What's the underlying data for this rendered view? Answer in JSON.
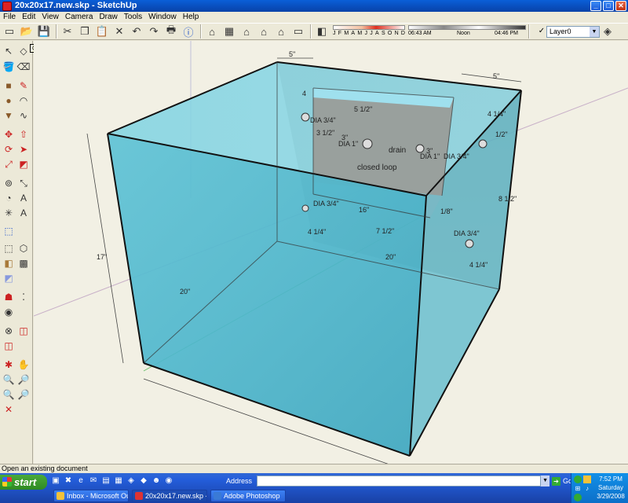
{
  "window": {
    "title": "20x20x17.new.skp - SketchUp",
    "min": "_",
    "max": "□",
    "close": "✕"
  },
  "menu": [
    "File",
    "Edit",
    "View",
    "Camera",
    "Draw",
    "Tools",
    "Window",
    "Help"
  ],
  "toolbar": {
    "months": [
      "J",
      "F",
      "M",
      "A",
      "M",
      "J",
      "J",
      "A",
      "S",
      "O",
      "N",
      "D"
    ],
    "time_start": "06:43 AM",
    "time_noon": "Noon",
    "time_end": "04:46 PM",
    "layer_check": "✓",
    "layer_name": "Layer0"
  },
  "tooltip": "Open",
  "model": {
    "dims": {
      "top_width": "5\"",
      "top_right": "5\"",
      "height": "17\"",
      "front_left": "20\"",
      "back_bottom": "20\"",
      "overflow_width": "5 1/2\"",
      "left_4": "4",
      "right_4_1_4": "4 1/4\"",
      "right_1_2": "1/2\"",
      "right_8_1_2": "8 1/2\"",
      "box_3_1_2": "3 1/2\"",
      "dim_3_left": "3\"",
      "dim_3_right": "3\"",
      "dim_16": "16\"",
      "dim_1_8": "1/8\"",
      "dim_4_1_4_lower": "4 1/4\"",
      "dim_7_1_2": "7 1/2\"",
      "dim_4_1_4_br": "4 1/4\"",
      "dim_20_back": "20\""
    },
    "holes": {
      "dia_3_4_upper": "DIA 3/4\"",
      "dia_1_left": "DIA 1\"",
      "dia_1_right": "DIA 1\"",
      "dia_3_4_far_right": "DIA 3/4\"",
      "dia_3_4_lower_left": "DIA 3/4\"",
      "dia_3_4_lower_right": "DIA 3/4\"",
      "drain": "drain",
      "closed_loop": "closed loop"
    }
  },
  "status": "Open an existing document",
  "taskbar": {
    "start": "start",
    "address_label": "Address",
    "address_value": "",
    "go": "Go",
    "tasks": [
      "Inbox - Microsoft Out...",
      "20x20x17.new.skp - ...",
      "Adobe Photoshop"
    ],
    "clock_time": "7:52 PM",
    "clock_day": "Saturday",
    "clock_date": "3/29/2008"
  }
}
